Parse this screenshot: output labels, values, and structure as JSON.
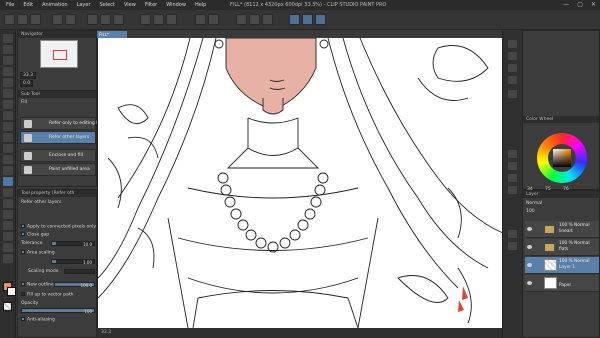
{
  "window": {
    "title": "FILL* (8112 x 4320px 600dpi 33.3%) - CLIP STUDIO PAINT PRO",
    "menu": [
      "File",
      "Edit",
      "Animation",
      "Layer",
      "Select",
      "View",
      "Filter",
      "Window",
      "Help"
    ],
    "controls": [
      "—",
      "▢",
      "✕"
    ]
  },
  "navigator": {
    "title": "Navigator",
    "zoom": "33.3",
    "rotation": "0.0"
  },
  "subtool": {
    "title": "Sub Tool",
    "group": "Fill",
    "items": [
      {
        "label": "Refer only to editing layer",
        "selected": false
      },
      {
        "label": "Refer other layers",
        "selected": true
      },
      {
        "label": "Enclose and fill",
        "selected": false
      },
      {
        "label": "Paint unfilled area",
        "selected": false
      }
    ]
  },
  "tool_property": {
    "title": "Tool property (Refer oth",
    "subtool_name": "Refer other layers",
    "apply_connected": "Apply to connected pixels only",
    "close_gap": "Close gap",
    "tolerance_label": "Tolerance",
    "tolerance": "10.0",
    "area_scaling_label": "Area scaling",
    "area_scaling": "1.00",
    "scaling_mode_label": "Scaling mode",
    "new_outline_label": "New outline",
    "new_outline": "100.0",
    "fill_vector_label": "Fill up to vector path",
    "opacity_label": "Opacity",
    "opacity": "100",
    "antialias_label": "Anti-aliasing"
  },
  "canvas": {
    "tab_label": "FILL*",
    "status_zoom": "33.3",
    "status_coords": "0.0"
  },
  "color_wheel": {
    "title": "Color Wheel",
    "h": "34",
    "s": "75",
    "v": "76",
    "main_color": "#e8906a"
  },
  "layers": {
    "title": "Layer",
    "blend_mode": "Normal",
    "opacity": "100",
    "rows": [
      {
        "line1": "100 % Normal",
        "line2": "lineart",
        "type": "folder",
        "selected": false
      },
      {
        "line1": "100 % Normal",
        "line2": "flats",
        "type": "folder",
        "selected": false
      },
      {
        "line1": "100 % Normal",
        "line2": "Layer 1",
        "type": "raster",
        "selected": true
      },
      {
        "line1": "",
        "line2": "Paper",
        "type": "paper",
        "selected": false
      }
    ]
  },
  "palette": {
    "skin_fill": "#e8b1a6",
    "red_fill": "#d84a2d",
    "accent": "#5a7fa8"
  }
}
